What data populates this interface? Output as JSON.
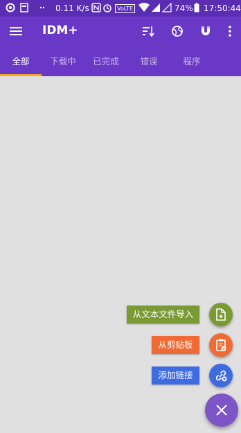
{
  "status_bar": {
    "net_speed": "0.11 K/s",
    "volte": "VoLTE",
    "battery": "74%",
    "time": "17:50:44"
  },
  "toolbar": {
    "title": "IDM+",
    "icons": [
      "menu-icon",
      "sort-icon",
      "globe-icon",
      "magnet-icon",
      "more-vert-icon"
    ]
  },
  "tabs": [
    {
      "label": "全部",
      "active": true
    },
    {
      "label": "下载中",
      "active": false
    },
    {
      "label": "已完成",
      "active": false
    },
    {
      "label": "错误",
      "active": false
    },
    {
      "label": "程序",
      "active": false
    }
  ],
  "fab_menu": [
    {
      "label": "从文本文件导入",
      "icon": "file-import-icon",
      "color": "#7a9a34"
    },
    {
      "label": "从剪贴板",
      "icon": "clipboard-icon",
      "color": "#f06a35"
    },
    {
      "label": "添加链接",
      "icon": "link-add-icon",
      "color": "#3f6be0"
    }
  ],
  "fab_main": {
    "icon": "close-icon",
    "color": "#7e55c7"
  },
  "colors": {
    "accent": "#6a38c6",
    "status": "#5a2db3",
    "indicator": "#f5a623"
  }
}
